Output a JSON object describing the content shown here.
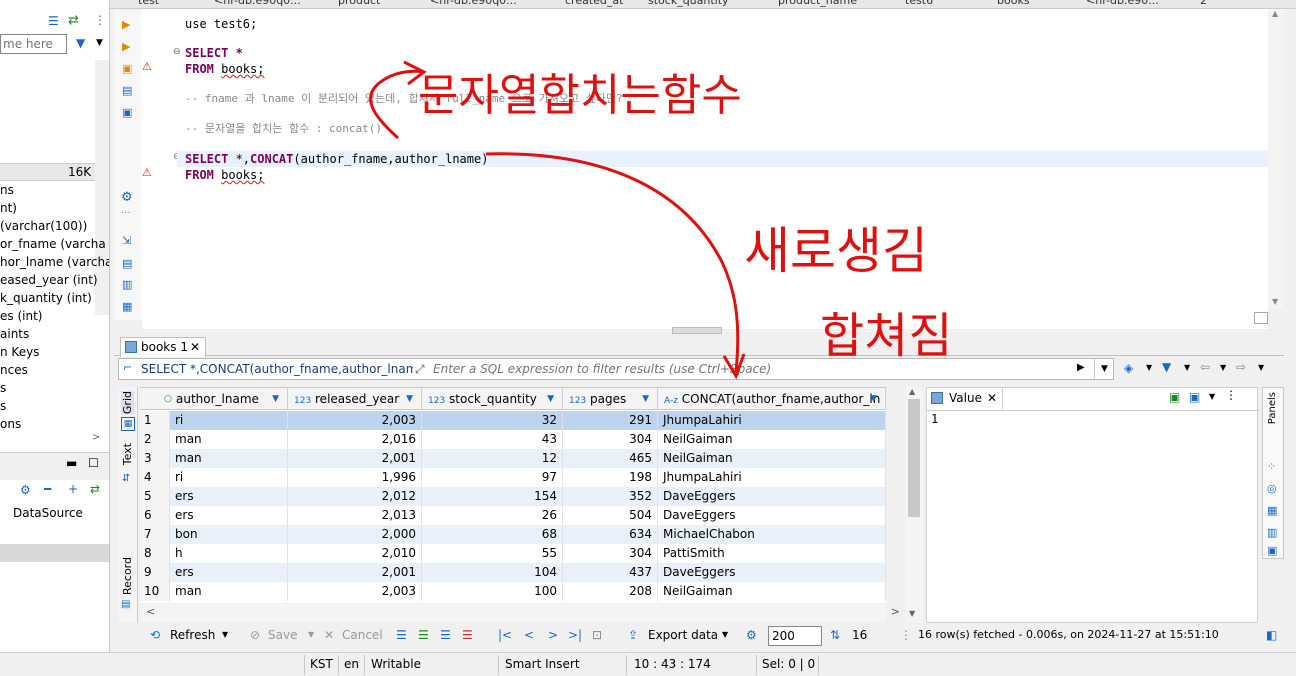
{
  "top_tabs": [
    "test",
    "<hr-db.e90q0...",
    "product",
    "<hr-db.e90q0...",
    "created_at",
    "stock_quantity",
    "product_name",
    "test6",
    "books",
    "<hr-db.e90...",
    "2"
  ],
  "left_panel": {
    "search_placeholder": "me here",
    "size_label": "16K",
    "tree": [
      "ns",
      "nt)",
      "(varchar(100))",
      "or_fname (varcha",
      "hor_lname (varcha",
      "eased_year (int)",
      "k_quantity (int)",
      "es (int)",
      "aints",
      "n Keys",
      "nces",
      "s",
      "s",
      "ons"
    ],
    "datasource": "DataSource"
  },
  "editor": {
    "lines": [
      {
        "parts": [
          {
            "t": "use test6;",
            "c": "fn"
          }
        ]
      },
      {
        "parts": [
          {
            "t": "SELECT *",
            "c": "kw"
          }
        ]
      },
      {
        "parts": [
          {
            "t": "FROM ",
            "c": "kw"
          },
          {
            "t": "books;",
            "c": "fn"
          }
        ]
      },
      {
        "parts": [
          {
            "t": "-- fname 과 lname 이 분리되어 있는데, 합쳐서 full_name 으로 가져오고 싶다면?",
            "c": "cm"
          }
        ]
      },
      {
        "parts": [
          {
            "t": "-- 문자열을 합치는 함수 : concat()",
            "c": "cm"
          }
        ]
      },
      {
        "parts": [
          {
            "t": "SELECT ",
            "c": "kw"
          },
          {
            "t": "*,",
            "c": "fn"
          },
          {
            "t": "CONCAT",
            "c": "kw"
          },
          {
            "t": "(author_fname,author_lname)",
            "c": "fn"
          }
        ]
      },
      {
        "parts": [
          {
            "t": "FROM ",
            "c": "kw"
          },
          {
            "t": "books;",
            "c": "fn"
          }
        ]
      }
    ]
  },
  "annotations": {
    "a1": "문자열합치는함수",
    "a2": "새로생김",
    "a3": "합쳐짐"
  },
  "results": {
    "tab_label": "books 1",
    "query_text": "SELECT *,CONCAT(author_fname,author_lname) F",
    "filter_placeholder": "Enter a SQL expression to filter results (use Ctrl+Space)",
    "side_tabs": [
      "Grid",
      "Text",
      "Record"
    ],
    "columns": [
      {
        "label": "author_lname",
        "type": "○"
      },
      {
        "label": "released_year",
        "type": "123"
      },
      {
        "label": "stock_quantity",
        "type": "123"
      },
      {
        "label": "pages",
        "type": "123"
      },
      {
        "label": "CONCAT(author_fname,author_ln",
        "type": "A-z"
      }
    ],
    "rows": [
      [
        "1",
        "ri",
        "2,003",
        "32",
        "291",
        "JhumpaLahiri"
      ],
      [
        "2",
        "man",
        "2,016",
        "43",
        "304",
        "NeilGaiman"
      ],
      [
        "3",
        "man",
        "2,001",
        "12",
        "465",
        "NeilGaiman"
      ],
      [
        "4",
        "ri",
        "1,996",
        "97",
        "198",
        "JhumpaLahiri"
      ],
      [
        "5",
        "ers",
        "2,012",
        "154",
        "352",
        "DaveEggers"
      ],
      [
        "6",
        "ers",
        "2,013",
        "26",
        "504",
        "DaveEggers"
      ],
      [
        "7",
        "bon",
        "2,000",
        "68",
        "634",
        "MichaelChabon"
      ],
      [
        "8",
        "h",
        "2,010",
        "55",
        "304",
        "PattiSmith"
      ],
      [
        "9",
        "ers",
        "2,001",
        "104",
        "437",
        "DaveEggers"
      ],
      [
        "10",
        "man",
        "2,003",
        "100",
        "208",
        "NeilGaiman"
      ]
    ]
  },
  "value_panel": {
    "title": "Value",
    "value": "1",
    "side_label": "Panels"
  },
  "bottom_toolbar": {
    "refresh": "Refresh",
    "save": "Save",
    "cancel": "Cancel",
    "export": "Export data",
    "fetch_size": "200",
    "count": "16",
    "status": "16 row(s) fetched - 0.006s, on 2024-11-27 at 15:51:10"
  },
  "statusbar": {
    "tz": "KST",
    "lang": "en",
    "mode": "Writable",
    "insert": "Smart Insert",
    "pos": "10 : 43 : 174",
    "sel": "Sel: 0 | 0"
  },
  "colors": {
    "accent": "#1a66cc",
    "annotation": "#e01010",
    "keyword": "#7f0055",
    "selection": "#bcd4ee"
  }
}
